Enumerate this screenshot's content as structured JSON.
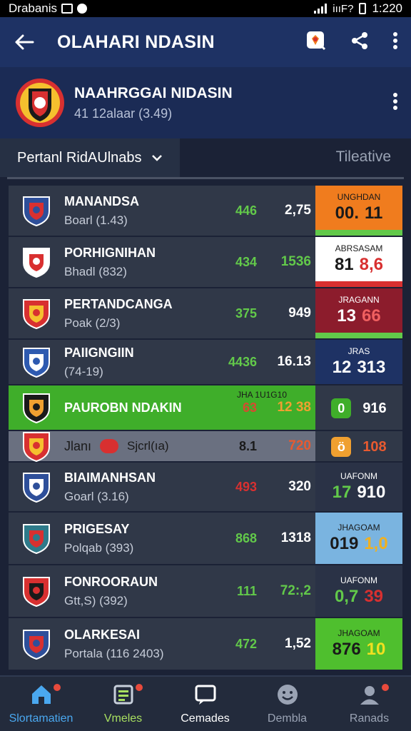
{
  "status": {
    "carrier": "Drabanis",
    "signal_text": "iııF?",
    "time": "1:220"
  },
  "app_bar": {
    "title": "OLAHARI NDASIN"
  },
  "league": {
    "name": "NAAHRGGAI NIDASIN",
    "subtitle": "41 12alaar (3.49)"
  },
  "filter": {
    "dropdown_label": "Pertanl RidAUlnabs",
    "right_tab": "Tileative"
  },
  "rows": [
    {
      "name": "MANANDSA",
      "sub": "Boarl (1.43)",
      "a": "446",
      "a_color": "#62c94a",
      "b": "2,75",
      "b_color": "#ffffff",
      "card_label": "UNGHDAN",
      "card_left": "00.",
      "card_right": "11",
      "card_bg": "#f07c1e",
      "card_left_color": "#1a1a1a",
      "card_right_color": "#1a1a1a",
      "card_label_color": "#1a1a1a",
      "card_stripe": "#62c94a",
      "crest_color": "#2e4f9a",
      "crest_accent": "#d93030"
    },
    {
      "name": "PORHIGNIHAN",
      "sub": "Bhadl (832)",
      "a": "434",
      "a_color": "#62c94a",
      "b": "1536",
      "b_color": "#62c94a",
      "card_label": "ABRSASAM",
      "card_left": "81",
      "card_right": "8,6",
      "card_bg": "#ffffff",
      "card_left_color": "#1a1a1a",
      "card_right_color": "#d83030",
      "card_label_color": "#1a1a1a",
      "card_stripe": "#d83030",
      "crest_color": "#ffffff",
      "crest_accent": "#d93030"
    },
    {
      "name": "PERTANDCANGA",
      "sub": "Poak (2/3)",
      "a": "375",
      "a_color": "#62c94a",
      "b": "949",
      "b_color": "#ffffff",
      "card_label": "JRAGANN",
      "card_left": "13",
      "card_right": "66",
      "card_bg": "#8c1c2c",
      "card_left_color": "#ffffff",
      "card_right_color": "#f06060",
      "card_label_color": "#ffffff",
      "card_stripe": "#62c94a",
      "crest_color": "#d83030",
      "crest_accent": "#f5c02e"
    },
    {
      "name": "PAIIGNGIIN",
      "sub": "(74-19)",
      "a": "4436",
      "a_color": "#62c94a",
      "b": "16.13",
      "b_color": "#ffffff",
      "card_label": "JRAS",
      "card_left": "12",
      "card_right": "313",
      "card_bg": "#1e3264",
      "card_left_color": "#ffffff",
      "card_right_color": "#ffffff",
      "card_label_color": "#ffffff",
      "card_stripe": "",
      "crest_color": "#2e5ab0",
      "crest_accent": "#ffffff"
    },
    {
      "name": "PAUROBN NDAKIN",
      "sub": "",
      "a": "63",
      "a_color": "#d84a30",
      "b": "12 38",
      "b_color": "#f0a030",
      "card_label": "",
      "card_left": "",
      "card_right": "916",
      "card_bg": "#303848",
      "card_left_color": "#ffffff",
      "card_right_color": "#ffffff",
      "card_label_color": "#ffffff",
      "card_stripe": "",
      "crest_color": "#1a1a1a",
      "crest_accent": "#f0a030",
      "highlight_label": "JHA 1U1G10",
      "tag": "0"
    },
    {
      "name": "Jlanı",
      "sub": "Sjcrl(ıa)",
      "a": "8.1",
      "a_color": "#1a1a1a",
      "b": "720",
      "b_color": "#e85a30",
      "card_label": "",
      "card_left": "",
      "card_right": "108",
      "card_bg": "#303848",
      "card_left_color": "#ffffff",
      "card_right_color": "#e85a30",
      "card_label_color": "#ffffff",
      "card_stripe": "",
      "crest_color": "#d83030",
      "crest_accent": "#f5c02e",
      "tag": "ö"
    },
    {
      "name": "BIAIMANHSAN",
      "sub": "Goarl (3.16)",
      "a": "493",
      "a_color": "#d83030",
      "b": "320",
      "b_color": "#ffffff",
      "card_label": "UAFONM",
      "card_left": "17",
      "card_right": "910",
      "card_bg": "#2a3246",
      "card_left_color": "#62c94a",
      "card_right_color": "#ffffff",
      "card_label_color": "#ffffff",
      "card_stripe": "",
      "crest_color": "#2e4f9a",
      "crest_accent": "#ffffff"
    },
    {
      "name": "PRIGESAY",
      "sub": "Polqab (393)",
      "a": "868",
      "a_color": "#62c94a",
      "b": "1318",
      "b_color": "#ffffff",
      "card_label": "JHAGOAM",
      "card_left": "019",
      "card_right": "1,0",
      "card_bg": "#7ab4e0",
      "card_left_color": "#1a1a1a",
      "card_right_color": "#f0b020",
      "card_label_color": "#1a1a1a",
      "card_stripe": "",
      "crest_color": "#2e7a8a",
      "crest_accent": "#d83030"
    },
    {
      "name": "FONROORAUN",
      "sub": "Gtt,S) (392)",
      "a": "111",
      "a_color": "#62c94a",
      "b": "72:,2",
      "b_color": "#62c94a",
      "card_label": "UAFONM",
      "card_left": "0,7",
      "card_right": "39",
      "card_bg": "#2a3246",
      "card_left_color": "#62c94a",
      "card_right_color": "#d83030",
      "card_label_color": "#ffffff",
      "card_stripe": "",
      "crest_color": "#d83030",
      "crest_accent": "#1a1a1a"
    },
    {
      "name": "OLARKESAI",
      "sub": "Portala (116 2403)",
      "a": "472",
      "a_color": "#62c94a",
      "b": "1,52",
      "b_color": "#ffffff",
      "card_label": "JHAGOAM",
      "card_left": "876",
      "card_right": "10",
      "card_bg": "#4fbf2e",
      "card_left_color": "#1a1a1a",
      "card_right_color": "#f0e020",
      "card_label_color": "#1a1a1a",
      "card_stripe": "",
      "crest_color": "#2e4f9a",
      "crest_accent": "#d83030"
    }
  ],
  "nav": [
    {
      "label": "Slortamatien",
      "color": "#4aa8f0",
      "icon": "home-icon",
      "badge": true
    },
    {
      "label": "Vmeles",
      "color": "#a8e060",
      "icon": "news-icon",
      "badge": true
    },
    {
      "label": "Cemades",
      "color": "#ffffff",
      "icon": "chat-icon",
      "badge": false
    },
    {
      "label": "Dembla",
      "color": "#9aa3b4",
      "icon": "emoji-icon",
      "badge": false
    },
    {
      "label": "Ranads",
      "color": "#9aa3b4",
      "icon": "profile-icon",
      "badge": true
    }
  ]
}
